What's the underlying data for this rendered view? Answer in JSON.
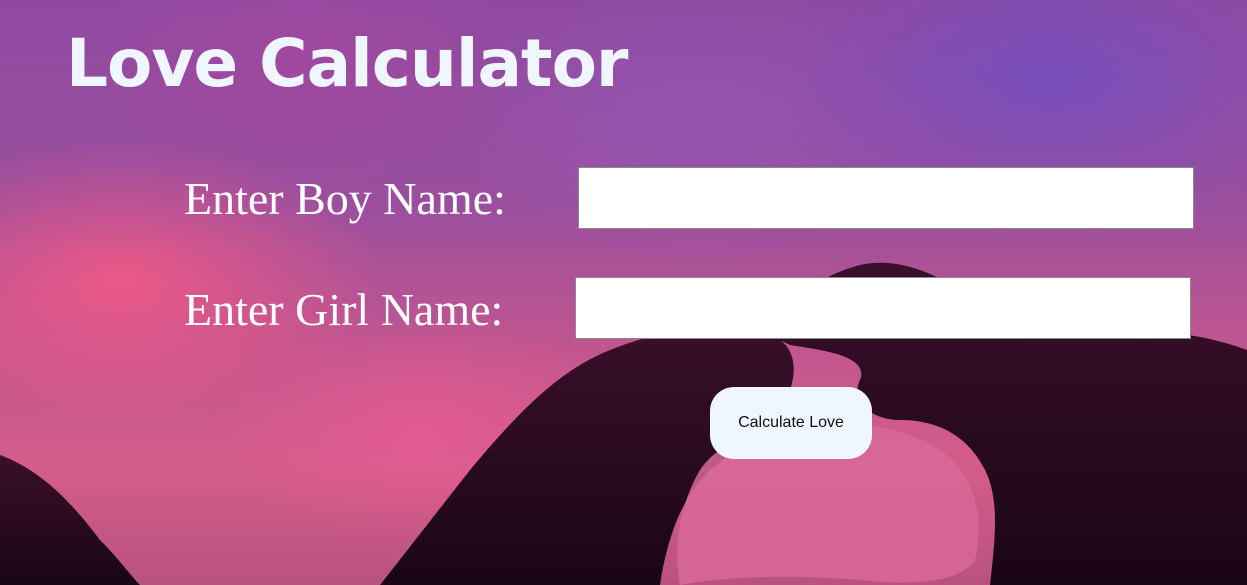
{
  "page": {
    "title": "Love Calculator"
  },
  "form": {
    "boy_label": "Enter Boy Name:",
    "boy_value": "",
    "girl_label": "Enter Girl Name:",
    "girl_value": "",
    "calculate_label": "Calculate Love"
  },
  "colors": {
    "title": "#f0f6ff",
    "button_bg": "#eef6ff",
    "silhouette": "#2a0a1e"
  }
}
